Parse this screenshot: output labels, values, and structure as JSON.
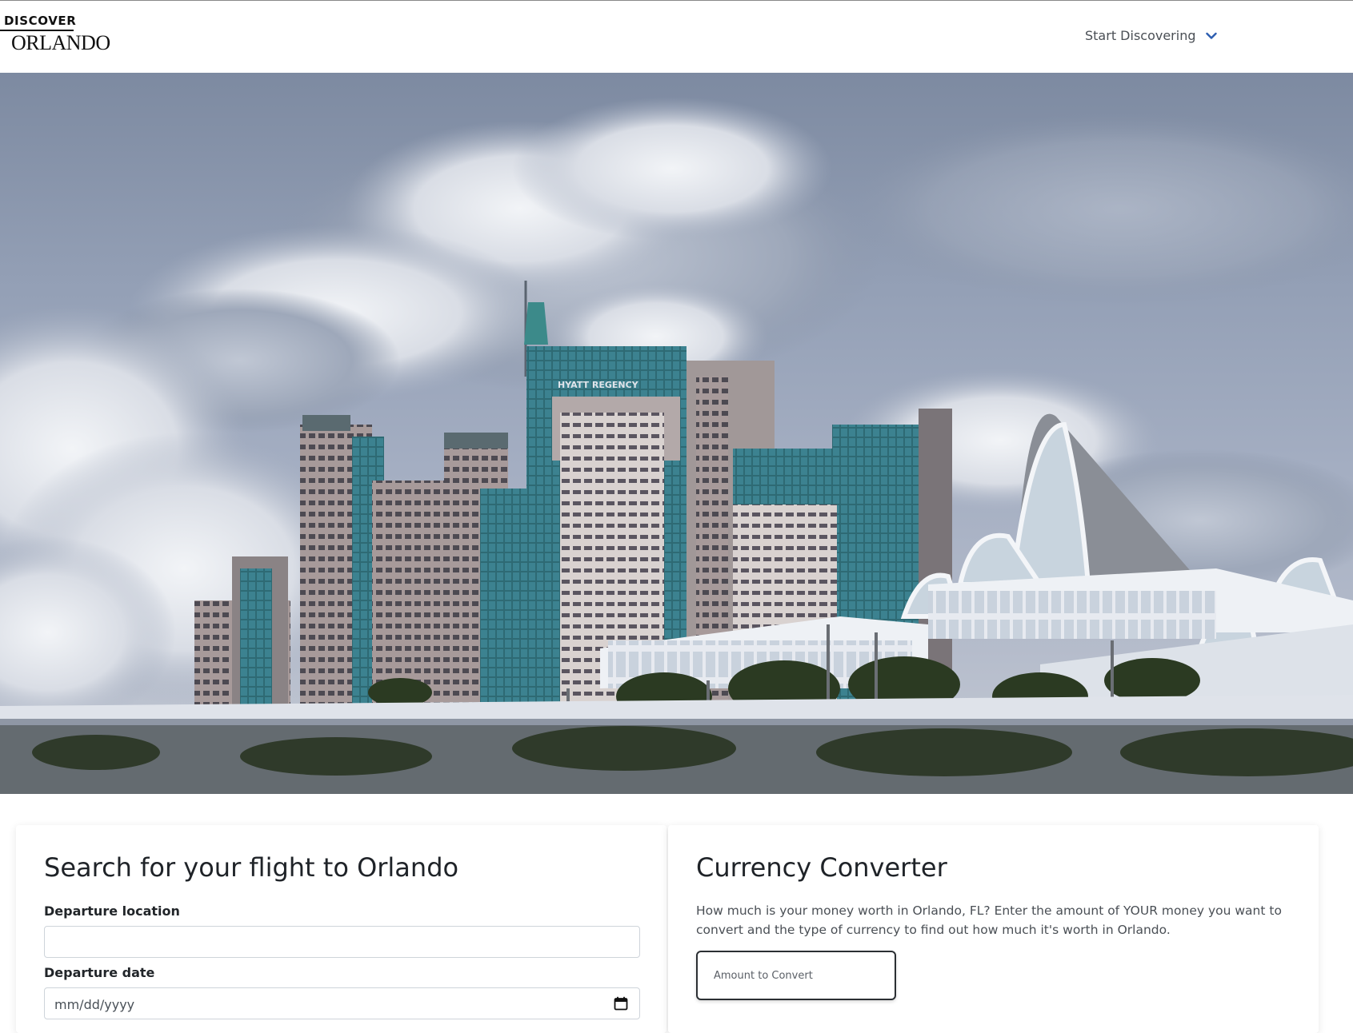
{
  "header": {
    "logo_top": "DISCOVER",
    "logo_bottom": "ORLANDO",
    "nav_label": "Start Discovering",
    "nav_icon": "chevron-down-icon",
    "accent_color": "#2c5db0"
  },
  "hero": {
    "building_sign": "HYATT REGENCY"
  },
  "flight": {
    "title": "Search for your flight to Orlando",
    "departure_location_label": "Departure location",
    "departure_location_value": "",
    "departure_date_label": "Departure date",
    "departure_date_placeholder": "mm/dd/yyyy",
    "calendar_icon": "calendar-icon"
  },
  "currency": {
    "title": "Currency Converter",
    "description": "How much is your money worth in Orlando, FL? Enter the amount of YOUR money you want to convert and the type of currency to find out how much it's worth in Orlando.",
    "amount_placeholder": "Amount to Convert"
  }
}
